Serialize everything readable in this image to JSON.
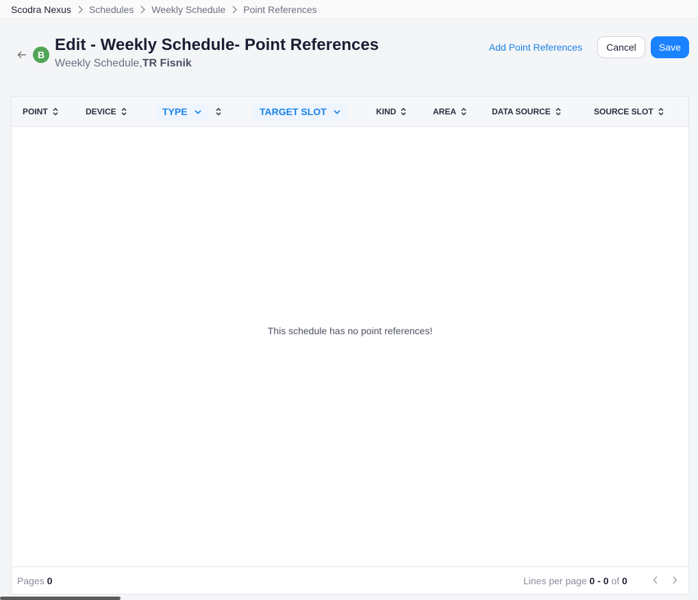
{
  "breadcrumb": {
    "items": [
      "Scodra Nexus",
      "Schedules",
      "Weekly Schedule",
      "Point References"
    ]
  },
  "header": {
    "avatar_letter": "B",
    "title": "Edit - Weekly Schedule- Point References",
    "subtitle_prefix": "Weekly Schedule,",
    "subtitle_bold": "TR Fisnik"
  },
  "actions": {
    "add_label": "Add Point References",
    "cancel_label": "Cancel",
    "save_label": "Save"
  },
  "table": {
    "columns": {
      "point": "POINT",
      "device": "DEVICE",
      "type": "TYPE",
      "target_slot": "TARGET SLOT",
      "kind": "KIND",
      "area": "AREA",
      "data_source": "DATA SOURCE",
      "source_slot": "SOURCE SLOT"
    },
    "empty_message": "This schedule has no point references!"
  },
  "footer": {
    "pages_label": "Pages",
    "pages_value": "0",
    "lines_label": "Lines per page",
    "range": "0 - 0",
    "of_label": "of",
    "total": "0"
  },
  "colors": {
    "accent": "#1a82ff",
    "avatar": "#52a657"
  }
}
